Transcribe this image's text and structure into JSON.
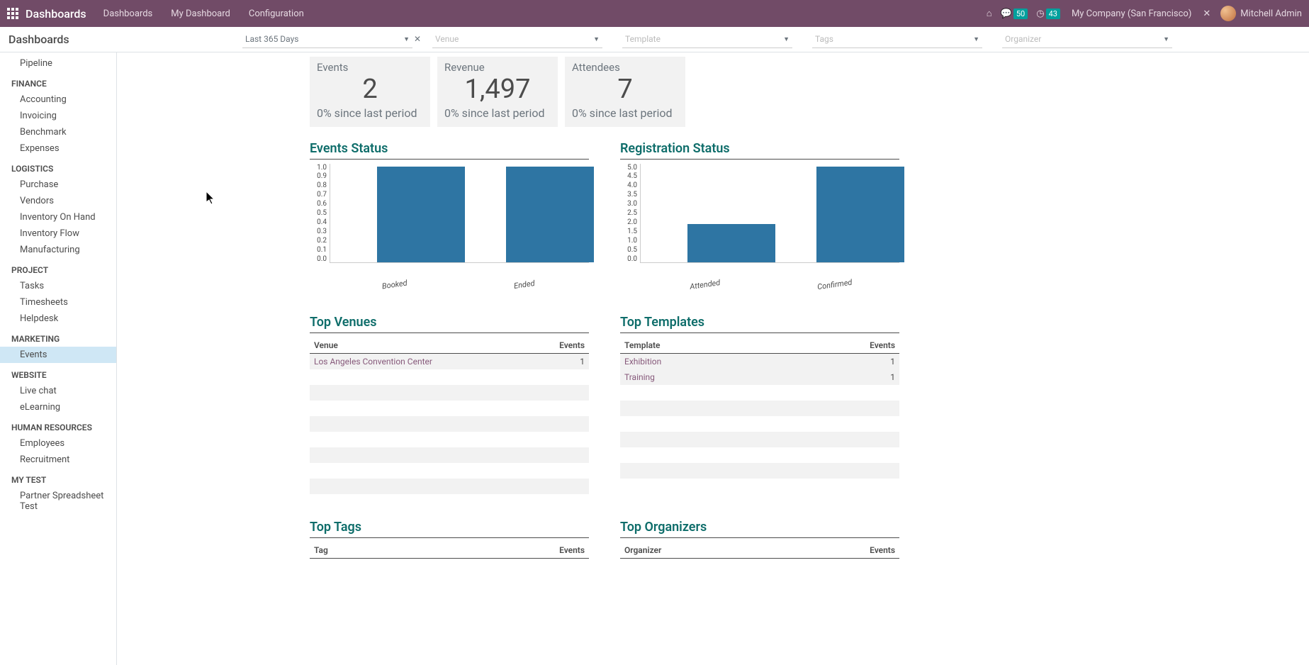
{
  "topnav": {
    "brand": "Dashboards",
    "menu": [
      "Dashboards",
      "My Dashboard",
      "Configuration"
    ],
    "msg_count": "50",
    "clock_count": "43",
    "company": "My Company (San Francisco)",
    "user": "Mitchell Admin"
  },
  "subbar": {
    "title": "Dashboards",
    "filters": [
      {
        "label": "Last 365 Days",
        "placeholder": false,
        "clearable": true
      },
      {
        "label": "Venue",
        "placeholder": true,
        "clearable": false
      },
      {
        "label": "Template",
        "placeholder": true,
        "clearable": false
      },
      {
        "label": "Tags",
        "placeholder": true,
        "clearable": false
      },
      {
        "label": "Organizer",
        "placeholder": true,
        "clearable": false
      }
    ]
  },
  "sidebar": [
    {
      "type": "item",
      "label": "Pipeline"
    },
    {
      "type": "group",
      "label": "FINANCE"
    },
    {
      "type": "item",
      "label": "Accounting"
    },
    {
      "type": "item",
      "label": "Invoicing"
    },
    {
      "type": "item",
      "label": "Benchmark"
    },
    {
      "type": "item",
      "label": "Expenses"
    },
    {
      "type": "group",
      "label": "LOGISTICS"
    },
    {
      "type": "item",
      "label": "Purchase"
    },
    {
      "type": "item",
      "label": "Vendors"
    },
    {
      "type": "item",
      "label": "Inventory On Hand"
    },
    {
      "type": "item",
      "label": "Inventory Flow"
    },
    {
      "type": "item",
      "label": "Manufacturing"
    },
    {
      "type": "group",
      "label": "PROJECT"
    },
    {
      "type": "item",
      "label": "Tasks"
    },
    {
      "type": "item",
      "label": "Timesheets"
    },
    {
      "type": "item",
      "label": "Helpdesk"
    },
    {
      "type": "group",
      "label": "MARKETING"
    },
    {
      "type": "item",
      "label": "Events",
      "selected": true
    },
    {
      "type": "group",
      "label": "WEBSITE"
    },
    {
      "type": "item",
      "label": "Live chat"
    },
    {
      "type": "item",
      "label": "eLearning"
    },
    {
      "type": "group",
      "label": "HUMAN RESOURCES"
    },
    {
      "type": "item",
      "label": "Employees"
    },
    {
      "type": "item",
      "label": "Recruitment"
    },
    {
      "type": "group",
      "label": "MY TEST"
    },
    {
      "type": "item",
      "label": "Partner Spreadsheet Test"
    }
  ],
  "kpis": [
    {
      "label": "Events",
      "value": "2",
      "delta": "0% since last period"
    },
    {
      "label": "Revenue",
      "value": "1,497",
      "delta": "0% since last period"
    },
    {
      "label": "Attendees",
      "value": "7",
      "delta": "0% since last period"
    }
  ],
  "charts": {
    "events_status": {
      "title": "Events Status"
    },
    "registration_status": {
      "title": "Registration Status"
    }
  },
  "tables": {
    "top_venues": {
      "title": "Top Venues",
      "cols": [
        "Venue",
        "Events"
      ],
      "rows": [
        [
          "Los Angeles Convention Center",
          "1"
        ]
      ]
    },
    "top_templates": {
      "title": "Top Templates",
      "cols": [
        "Template",
        "Events"
      ],
      "rows": [
        [
          "Exhibition",
          "1"
        ],
        [
          "Training",
          "1"
        ]
      ]
    },
    "top_tags": {
      "title": "Top Tags",
      "cols": [
        "Tag",
        "Events"
      ],
      "rows": []
    },
    "top_organizers": {
      "title": "Top Organizers",
      "cols": [
        "Organizer",
        "Events"
      ],
      "rows": []
    }
  },
  "chart_data": [
    {
      "id": "events_status",
      "type": "bar",
      "title": "Events Status",
      "categories": [
        "Booked",
        "Ended"
      ],
      "values": [
        1,
        1
      ],
      "ylim": [
        0,
        1.0
      ],
      "yticks": [
        0,
        0.1,
        0.2,
        0.3,
        0.4,
        0.5,
        0.6,
        0.7,
        0.8,
        0.9,
        1.0
      ]
    },
    {
      "id": "registration_status",
      "type": "bar",
      "title": "Registration Status",
      "categories": [
        "Attended",
        "Confirmed"
      ],
      "values": [
        2,
        5
      ],
      "ylim": [
        0,
        5.0
      ],
      "yticks": [
        0,
        0.5,
        1.0,
        1.5,
        2.0,
        2.5,
        3.0,
        3.5,
        4.0,
        4.5,
        5.0
      ]
    }
  ]
}
